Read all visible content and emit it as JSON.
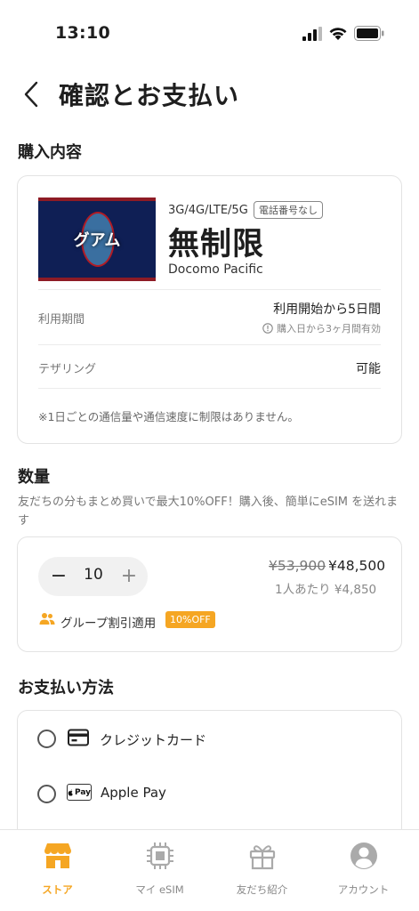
{
  "status_bar": {
    "time": "13:10"
  },
  "header": {
    "title": "確認とお支払い"
  },
  "purchase": {
    "section_title": "購入内容",
    "flag_label": "グアム",
    "network": "3G/4G/LTE/5G",
    "tag": "電話番号なし",
    "plan": "無制限",
    "operator": "Docomo Pacific",
    "period_label": "利用期間",
    "period_value": "利用開始から5日間",
    "period_note": "購入日から3ヶ月間有効",
    "tethering_label": "テザリング",
    "tethering_value": "可能",
    "note": "※1日ごとの通信量や通信速度に制限はありません。"
  },
  "quantity": {
    "section_title": "数量",
    "subtitle": "友だちの分もまとめ買いで最大10%OFF！購入後、簡単にeSIM を送れます",
    "minus": "−",
    "plus": "+",
    "value": "10",
    "original_price": "¥53,900",
    "price": "¥48,500",
    "per_person": "1人あたり ¥4,850",
    "group_label": "グループ割引適用",
    "badge": "10%OFF"
  },
  "payment": {
    "section_title": "お支払い方法",
    "methods": [
      {
        "label": "クレジットカード",
        "icon": "credit-card-icon"
      },
      {
        "label": "Apple Pay",
        "icon": "apple-pay-icon",
        "icon_text": "Pay"
      }
    ]
  },
  "tabbar": {
    "items": [
      {
        "label": "ストア",
        "icon": "store-icon",
        "active": true
      },
      {
        "label": "マイ eSIM",
        "icon": "chip-icon",
        "active": false
      },
      {
        "label": "友だち紹介",
        "icon": "gift-icon",
        "active": false
      },
      {
        "label": "アカウント",
        "icon": "account-icon",
        "active": false
      }
    ]
  },
  "colors": {
    "accent": "#f5a623",
    "text": "#1e1e1e",
    "muted": "#888888"
  }
}
